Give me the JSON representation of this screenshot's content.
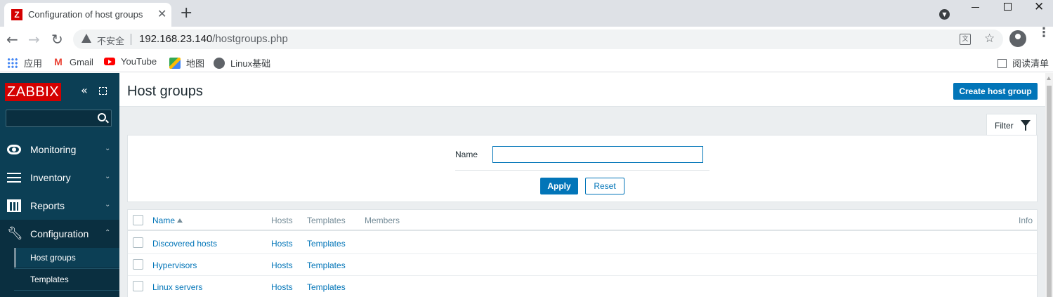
{
  "browser": {
    "tab_title": "Configuration of host groups",
    "tab_favicon_letter": "Z",
    "address": {
      "security_label": "不安全",
      "host": "192.168.23.140",
      "path": "/hostgroups.php"
    },
    "bookmarks": [
      {
        "label": "应用",
        "icon": "apps-grid-icon"
      },
      {
        "label": "Gmail",
        "icon": "gmail-icon"
      },
      {
        "label": "YouTube",
        "icon": "youtube-icon"
      },
      {
        "label": "地图",
        "icon": "maps-icon"
      },
      {
        "label": "Linux基础",
        "icon": "globe-icon"
      }
    ],
    "reading_list_label": "阅读清单"
  },
  "sidebar": {
    "logo": "ZABBIX",
    "menu": [
      {
        "label": "Monitoring",
        "icon": "eye-icon",
        "chevron": "⌄"
      },
      {
        "label": "Inventory",
        "icon": "list-icon",
        "chevron": "⌄"
      },
      {
        "label": "Reports",
        "icon": "bar-chart-icon",
        "chevron": "⌄"
      },
      {
        "label": "Configuration",
        "icon": "wrench-icon",
        "chevron": "⌃"
      }
    ],
    "submenu": [
      {
        "label": "Host groups",
        "selected": true
      },
      {
        "label": "Templates",
        "selected": false
      }
    ]
  },
  "main": {
    "title": "Host groups",
    "create_button": "Create host group",
    "filter": {
      "tab_label": "Filter",
      "name_label": "Name",
      "name_value": "",
      "apply_label": "Apply",
      "reset_label": "Reset"
    },
    "table": {
      "columns": [
        "Name",
        "Hosts",
        "Templates",
        "Members",
        "Info"
      ],
      "sort_column": "Name",
      "rows": [
        {
          "name": "Discovered hosts",
          "hosts": "Hosts",
          "templates": "Templates",
          "members": ""
        },
        {
          "name": "Hypervisors",
          "hosts": "Hosts",
          "templates": "Templates",
          "members": ""
        },
        {
          "name": "Linux servers",
          "hosts": "Hosts",
          "templates": "Templates",
          "members": ""
        }
      ]
    }
  },
  "colors": {
    "zabbix_red": "#d40000",
    "sidebar_bg": "#0c3f55",
    "link_blue": "#0275b8",
    "page_bg": "#ebeef0"
  }
}
